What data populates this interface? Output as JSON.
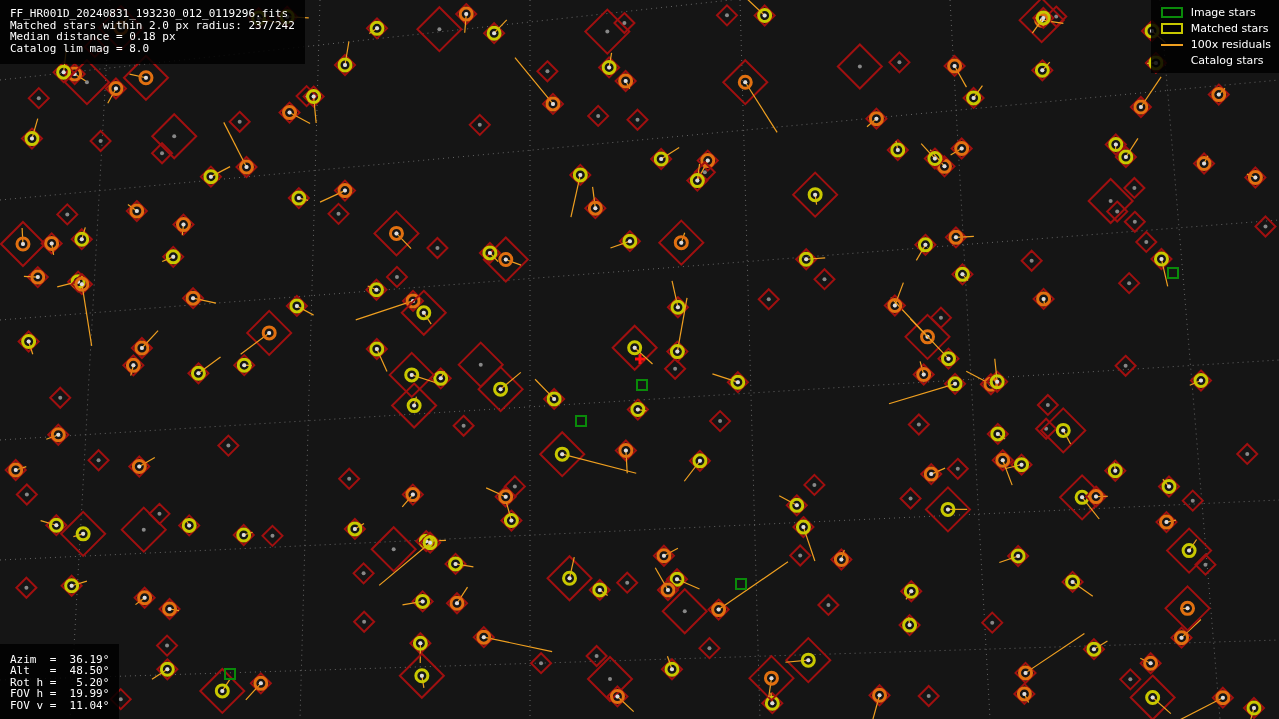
{
  "file_info": [
    "FF_HR001D_20240831_193230_012_0119296.fits",
    "Matched stars within 2.0 px radius: 237/242",
    "Median distance = 0.18 px",
    "Catalog lim mag = 8.0"
  ],
  "legend": [
    {
      "kind": "image",
      "label": "Image stars"
    },
    {
      "kind": "matched",
      "label": "Matched stars"
    },
    {
      "kind": "residual",
      "label": "100x residuals"
    },
    {
      "kind": "catalog",
      "label": "Catalog stars"
    }
  ],
  "pointing": [
    "Azim  =  36.19°",
    "Alt   =  48.50°",
    "Rot h =   5.20°",
    "FOV h =  19.99°",
    "FOV v =  11.04°"
  ]
}
